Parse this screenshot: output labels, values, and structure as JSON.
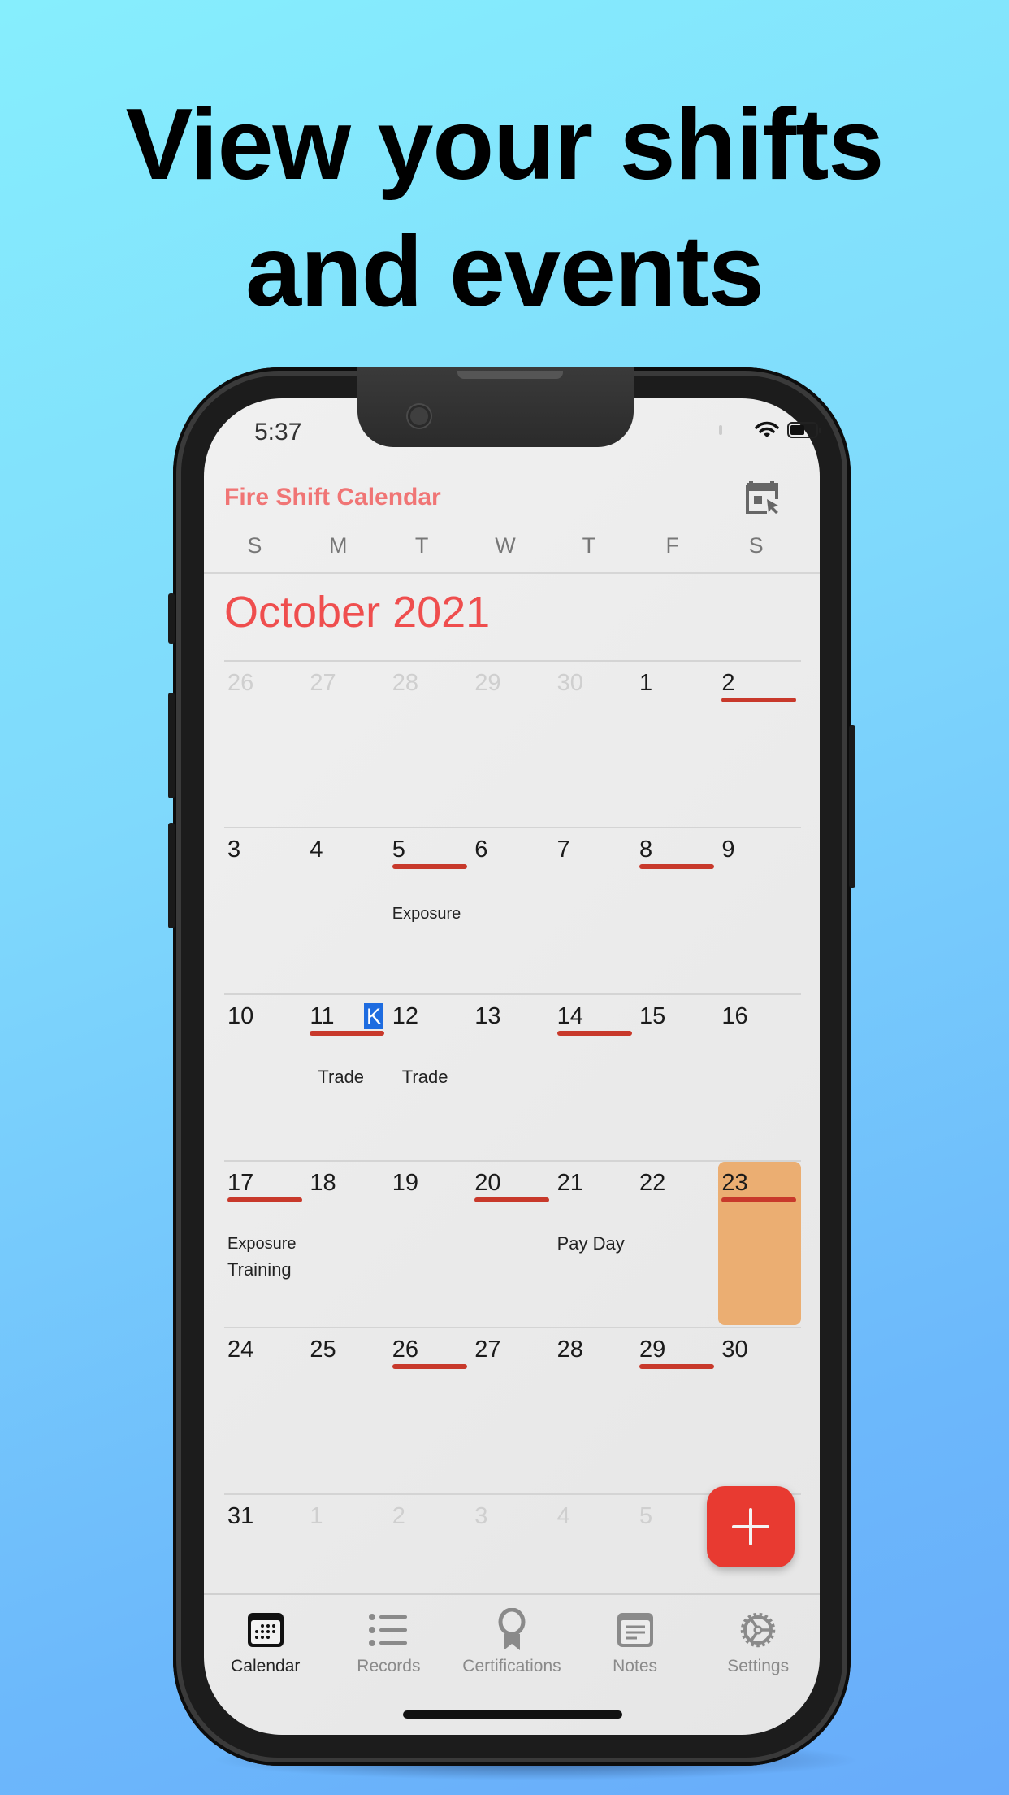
{
  "headline": {
    "line1": "View your shifts",
    "line2": "and events"
  },
  "status_bar": {
    "time": "5:37",
    "wifi_icon": "wifi-icon",
    "battery_icon": "battery-icon"
  },
  "app": {
    "title": "Fire Shift Calendar",
    "header_icon": "calendar-select-icon",
    "weekdays": [
      "S",
      "M",
      "T",
      "W",
      "T",
      "F",
      "S"
    ],
    "month_title": "October 2021",
    "colors": {
      "accent": "#ef4e4e",
      "shift": "#c8392b",
      "today": "#ebae72",
      "fab": "#e83a31"
    }
  },
  "calendar": {
    "weeks": [
      {
        "days": [
          {
            "num": "26",
            "dim": true
          },
          {
            "num": "27",
            "dim": true
          },
          {
            "num": "28",
            "dim": true
          },
          {
            "num": "29",
            "dim": true
          },
          {
            "num": "30",
            "dim": true
          },
          {
            "num": "1"
          },
          {
            "num": "2",
            "shift": true
          }
        ]
      },
      {
        "days": [
          {
            "num": "3"
          },
          {
            "num": "4"
          },
          {
            "num": "5",
            "shift": true,
            "events": [
              "Exposure"
            ]
          },
          {
            "num": "6"
          },
          {
            "num": "7"
          },
          {
            "num": "8",
            "shift": true
          },
          {
            "num": "9"
          }
        ]
      },
      {
        "days": [
          {
            "num": "10"
          },
          {
            "num": "11",
            "shift": true,
            "events": [
              "Trade"
            ],
            "badge": "K"
          },
          {
            "num": "12",
            "events": [
              "Trade"
            ]
          },
          {
            "num": "13"
          },
          {
            "num": "14",
            "shift": true
          },
          {
            "num": "15"
          },
          {
            "num": "16"
          }
        ]
      },
      {
        "days": [
          {
            "num": "17",
            "shift": true,
            "events": [
              "Exposure",
              "Training"
            ]
          },
          {
            "num": "18"
          },
          {
            "num": "19"
          },
          {
            "num": "20",
            "shift": true
          },
          {
            "num": "21",
            "events": [
              "Pay Day"
            ]
          },
          {
            "num": "22"
          },
          {
            "num": "23",
            "shift": true,
            "today": true
          }
        ]
      },
      {
        "days": [
          {
            "num": "24"
          },
          {
            "num": "25"
          },
          {
            "num": "26",
            "shift": true
          },
          {
            "num": "27"
          },
          {
            "num": "28"
          },
          {
            "num": "29",
            "shift": true
          },
          {
            "num": "30"
          }
        ]
      },
      {
        "days": [
          {
            "num": "31"
          },
          {
            "num": "1",
            "dim": true
          },
          {
            "num": "2",
            "dim": true
          },
          {
            "num": "3",
            "dim": true
          },
          {
            "num": "4",
            "dim": true
          },
          {
            "num": "5",
            "dim": true
          },
          {
            "num": "",
            "dim": true
          }
        ]
      }
    ]
  },
  "fab": {
    "icon": "plus-icon"
  },
  "tabbar": {
    "tabs": [
      {
        "label": "Calendar",
        "icon": "calendar-icon",
        "active": true
      },
      {
        "label": "Records",
        "icon": "list-icon"
      },
      {
        "label": "Certifications",
        "icon": "award-icon"
      },
      {
        "label": "Notes",
        "icon": "notes-icon"
      },
      {
        "label": "Settings",
        "icon": "gear-icon"
      }
    ]
  }
}
